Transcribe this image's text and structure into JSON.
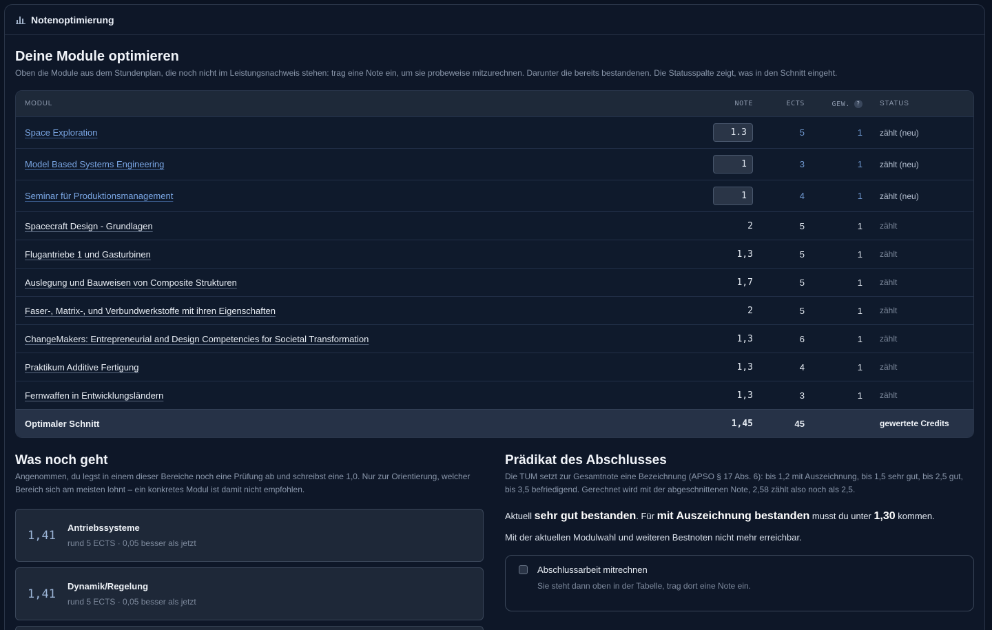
{
  "app": {
    "title": "Notenoptimierung",
    "icon": "bar-chart-icon"
  },
  "optimize": {
    "heading": "Deine Module optimieren",
    "description": "Oben die Module aus dem Stundenplan, die noch nicht im Leistungsnachweis stehen: trag eine Note ein, um sie probeweise mitzurechnen. Darunter die bereits bestandenen. Die Statusspalte zeigt, was in den Schnitt eingeht."
  },
  "table": {
    "headers": {
      "modul": "MODUL",
      "note": "NOTE",
      "ects": "ECTS",
      "gew": "GEW.",
      "gew_help": "?",
      "status": "STATUS"
    },
    "new_rows": [
      {
        "modul": "Space Exploration",
        "note": "1.3",
        "ects": "5",
        "gew": "1",
        "status": "zählt (neu)"
      },
      {
        "modul": "Model Based Systems Engineering",
        "note": "1",
        "ects": "3",
        "gew": "1",
        "status": "zählt (neu)"
      },
      {
        "modul": "Seminar für Produktionsmanagement",
        "note": "1",
        "ects": "4",
        "gew": "1",
        "status": "zählt (neu)"
      }
    ],
    "passed_rows": [
      {
        "modul": "Spacecraft Design - Grundlagen",
        "note": "2",
        "ects": "5",
        "gew": "1",
        "status": "zählt"
      },
      {
        "modul": "Flugantriebe 1 und Gasturbinen",
        "note": "1,3",
        "ects": "5",
        "gew": "1",
        "status": "zählt"
      },
      {
        "modul": "Auslegung und Bauweisen von Composite Strukturen",
        "note": "1,7",
        "ects": "5",
        "gew": "1",
        "status": "zählt"
      },
      {
        "modul": "Faser-, Matrix-, und Verbundwerkstoffe mit ihren Eigenschaften",
        "note": "2",
        "ects": "5",
        "gew": "1",
        "status": "zählt"
      },
      {
        "modul": "ChangeMakers: Entrepreneurial and Design Competencies for Societal Transformation",
        "note": "1,3",
        "ects": "6",
        "gew": "1",
        "status": "zählt"
      },
      {
        "modul": "Praktikum Additive Fertigung",
        "note": "1,3",
        "ects": "4",
        "gew": "1",
        "status": "zählt"
      },
      {
        "modul": "Fernwaffen in Entwicklungsländern",
        "note": "1,3",
        "ects": "3",
        "gew": "1",
        "status": "zählt"
      }
    ],
    "footer": {
      "label": "Optimaler Schnitt",
      "note": "1,45",
      "ects": "45",
      "status": "gewertete Credits"
    }
  },
  "what_next": {
    "heading": "Was noch geht",
    "description": "Angenommen, du legst in einem dieser Bereiche noch eine Prüfung ab und schreibst eine 1,0. Nur zur Orientierung, welcher Bereich sich am meisten lohnt – ein konkretes Modul ist damit nicht empfohlen.",
    "cards": [
      {
        "value": "1,41",
        "name": "Antriebssysteme",
        "sub": "rund 5 ECTS · 0,05 besser als jetzt"
      },
      {
        "value": "1,41",
        "name": "Dynamik/Regelung",
        "sub": "rund 5 ECTS · 0,05 besser als jetzt"
      }
    ]
  },
  "predicate": {
    "heading": "Prädikat des Abschlusses",
    "description": "Die TUM setzt zur Gesamtnote eine Bezeichnung (APSO § 17 Abs. 6): bis 1,2 mit Auszeichnung, bis 1,5 sehr gut, bis 2,5 gut, bis 3,5 befriedigend. Gerechnet wird mit der abgeschnittenen Note, 2,58 zählt also noch als 2,5.",
    "current_prefix": "Aktuell",
    "current_value": "sehr gut bestanden",
    "current_mid": ". Für",
    "target_value": "mit Auszeichnung bestanden",
    "target_mid": "musst du unter",
    "target_grade": "1,30",
    "target_suffix": "kommen.",
    "note": "Mit der aktuellen Modulwahl und weiteren Bestnoten nicht mehr erreichbar.",
    "option_label": "Abschlussarbeit mitrechnen",
    "option_hint": "Sie steht dann oben in der Tabelle, trag dort eine Note ein.",
    "option_checked": false
  }
}
